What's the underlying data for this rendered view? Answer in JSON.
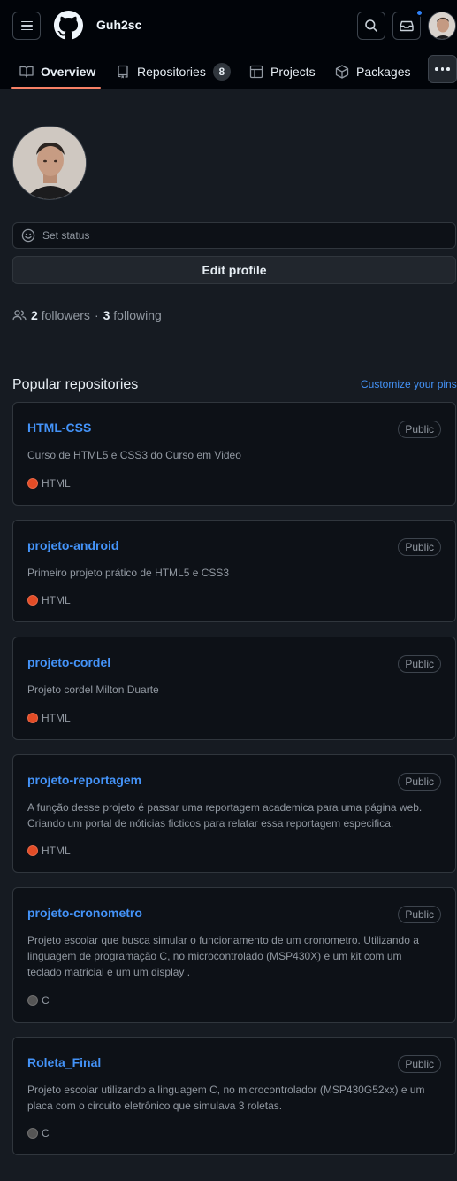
{
  "header": {
    "username": "Guh2sc",
    "notification_dot_color": "#2f81f7"
  },
  "tabs": [
    {
      "label": "Overview",
      "icon": "book-icon",
      "active": true
    },
    {
      "label": "Repositories",
      "icon": "repo-icon",
      "count": "8"
    },
    {
      "label": "Projects",
      "icon": "table-icon"
    },
    {
      "label": "Packages",
      "icon": "package-icon"
    }
  ],
  "profile": {
    "status_label": "Set status",
    "edit_profile_label": "Edit profile",
    "followers_count": "2",
    "followers_label": "followers",
    "separator": "·",
    "following_count": "3",
    "following_label": "following"
  },
  "popular": {
    "title": "Popular repositories",
    "customize_label": "Customize your pins",
    "repos": [
      {
        "name": "HTML-CSS",
        "visibility": "Public",
        "description": "Curso de HTML5 e CSS3 do Curso em Video",
        "language": "HTML",
        "language_color": "#e34c26"
      },
      {
        "name": "projeto-android",
        "visibility": "Public",
        "description": "Primeiro projeto prático de HTML5 e CSS3",
        "language": "HTML",
        "language_color": "#e34c26"
      },
      {
        "name": "projeto-cordel",
        "visibility": "Public",
        "description": "Projeto cordel Milton Duarte",
        "language": "HTML",
        "language_color": "#e34c26"
      },
      {
        "name": "projeto-reportagem",
        "visibility": "Public",
        "description": "A função desse projeto é passar uma reportagem academica para uma página web. Criando um portal de nóticias ficticos para relatar essa reportagem especifica.",
        "language": "HTML",
        "language_color": "#e34c26"
      },
      {
        "name": "projeto-cronometro",
        "visibility": "Public",
        "description": "Projeto escolar que busca simular o funcionamento de um cronometro. Utilizando a linguagem de programação C, no microcontrolado (MSP430X) e um kit com um teclado matricial e um um display .",
        "language": "C",
        "language_color": "#555555"
      },
      {
        "name": "Roleta_Final",
        "visibility": "Public",
        "description": "Projeto escolar utilizando a linguagem C, no microcontrolador (MSP430G52xx) e um placa com o circuito eletrônico que simulava 3 roletas.",
        "language": "C",
        "language_color": "#555555"
      }
    ]
  },
  "colors": {
    "page_bg": "#161b22",
    "header_bg": "#010409",
    "link": "#4493f8",
    "active_tab_underline": "#f78166"
  }
}
